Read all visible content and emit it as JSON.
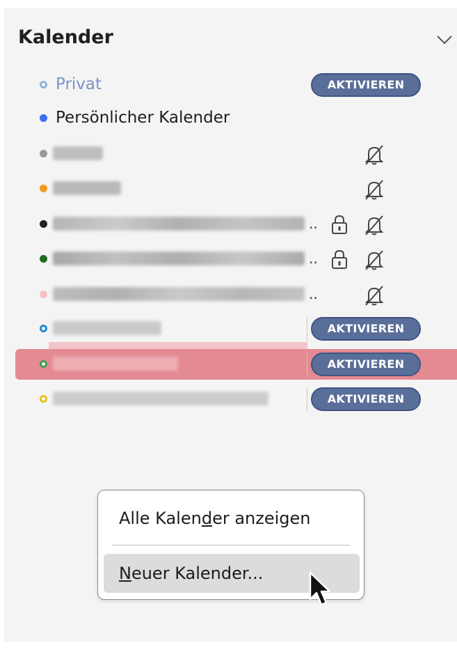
{
  "section": {
    "title": "Kalender",
    "collapse_icon": "chevron-down-icon"
  },
  "calendars": [
    {
      "label": "Privat",
      "dot_color": "#8fb0dc",
      "dot_style": "hollow",
      "action": "AKTIVIEREN"
    },
    {
      "label": "Persönlicher Kalender",
      "dot_color": "#3b6ef5",
      "dot_style": "filled"
    },
    {
      "dot_color": "#9a9a9a",
      "dot_style": "filled",
      "icons": [
        "bell-muted-icon"
      ]
    },
    {
      "dot_color": "#f39a1e",
      "dot_style": "filled",
      "icons": [
        "bell-muted-icon"
      ]
    },
    {
      "dot_color": "#222222",
      "dot_style": "filled",
      "icons": [
        "lock-icon",
        "bell-muted-icon"
      ]
    },
    {
      "dot_color": "#1f6b1f",
      "dot_style": "filled",
      "icons": [
        "lock-icon",
        "bell-muted-icon"
      ]
    },
    {
      "dot_color": "#f7c0c4",
      "dot_style": "filled",
      "icons": [
        "bell-muted-icon"
      ]
    },
    {
      "dot_color": "#1e88d8",
      "dot_style": "hollow",
      "action": "AKTIVIEREN"
    },
    {
      "dot_color": "#3aa14a",
      "dot_style": "hollow",
      "action": "AKTIVIEREN",
      "highlighted": true
    },
    {
      "dot_color": "#e6c21c",
      "dot_style": "hollow",
      "action": "AKTIVIEREN"
    }
  ],
  "ellipsis": "..",
  "context_menu": {
    "show_all": "Alle Kalender anzeigen",
    "show_all_mnemonic": "d",
    "new_calendar": "Neuer Kalender...",
    "new_calendar_mnemonic": "N"
  }
}
